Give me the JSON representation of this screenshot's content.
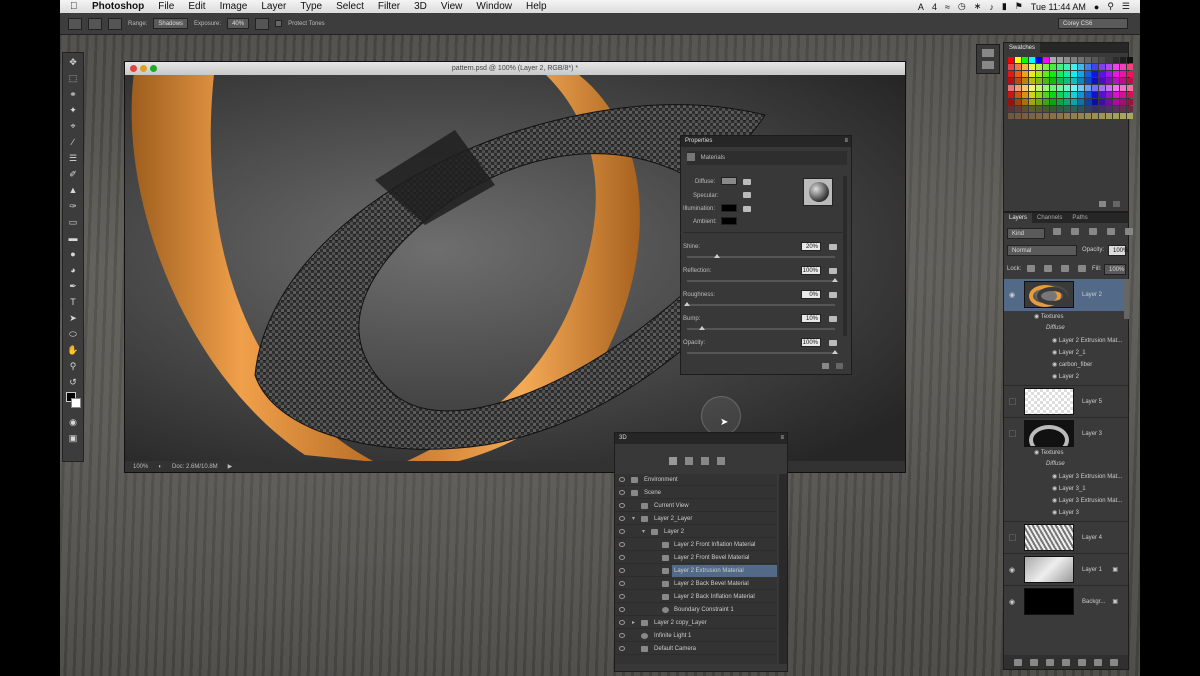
{
  "menubar": {
    "app_name": "Photoshop",
    "items": [
      "File",
      "Edit",
      "Image",
      "Layer",
      "Type",
      "Select",
      "Filter",
      "3D",
      "View",
      "Window",
      "Help"
    ],
    "status_num": "4",
    "clock": "Tue 11:44 AM"
  },
  "options": {
    "range_label": "Range:",
    "range_value": "Shadows",
    "exposure_label": "Exposure:",
    "exposure_value": "40%",
    "protect_tones": "Protect Tones",
    "workspace": "Corey CS6"
  },
  "document": {
    "title": "pattern.psd @ 100% (Layer 2, RGB/8*) *",
    "zoom": "100%",
    "doc_size": "Doc: 2.6M/10.8M"
  },
  "properties": {
    "panel_title": "Properties",
    "section": "Materials",
    "diffuse_label": "Diffuse:",
    "specular_label": "Specular:",
    "illumination_label": "Illumination:",
    "ambient_label": "Ambient:",
    "shine_label": "Shine:",
    "shine_value": "20%",
    "reflection_label": "Reflection:",
    "reflection_value": "100%",
    "roughness_label": "Roughness:",
    "roughness_value": "0%",
    "bump_label": "Bump:",
    "bump_value": "10%",
    "opacity_label": "Opacity:",
    "opacity_value": "100%",
    "shine_level": 0.2,
    "reflection_level": 1.0,
    "roughness_level": 0.0,
    "bump_level": 0.1,
    "opacity_level": 1.0
  },
  "panel3d": {
    "title": "3D",
    "rows": [
      {
        "label": "Environment"
      },
      {
        "label": "Scene"
      },
      {
        "label": "Current View"
      },
      {
        "label": "Layer 2_Layer"
      },
      {
        "label": "Layer 2"
      },
      {
        "label": "Layer 2 Front Inflation Material"
      },
      {
        "label": "Layer 2 Front Bevel Material"
      },
      {
        "label": "Layer 2 Extrusion Material"
      },
      {
        "label": "Layer 2 Back Bevel Material"
      },
      {
        "label": "Layer 2 Back Inflation Material"
      },
      {
        "label": "Boundary Constraint 1"
      },
      {
        "label": "Layer 2 copy_Layer"
      },
      {
        "label": "Infinite Light 1"
      },
      {
        "label": "Default Camera"
      }
    ]
  },
  "swatches": {
    "title": "Swatches"
  },
  "layers": {
    "tabs": [
      "Layers",
      "Channels",
      "Paths"
    ],
    "kind": "Kind",
    "blend": "Normal",
    "opacity_label": "Opacity:",
    "opacity_value": "100%",
    "lock_label": "Lock:",
    "fill_label": "Fill:",
    "fill_value": "100%",
    "layer2_name": "Layer 2",
    "textures_label": "Textures",
    "diffuse_label": "Diffuse",
    "l2_sub": [
      "Layer 2 Extrusion Mat...",
      "Layer 2_1",
      "carbon_fiber",
      "Layer 2"
    ],
    "layer5_name": "Layer 5",
    "layer3_name": "Layer 3",
    "l3_sub": [
      "Layer 3 Extrusion Mat...",
      "Layer 3_1",
      "Layer 3 Extrusion Mat...",
      "Layer 3"
    ],
    "layer4_name": "Layer 4",
    "layer1_name": "Layer 1",
    "background_name": "Backgr..."
  },
  "colors": {
    "orange": "#e89a3e",
    "carbon": "#3a3a3a",
    "selection": "#526a88"
  }
}
